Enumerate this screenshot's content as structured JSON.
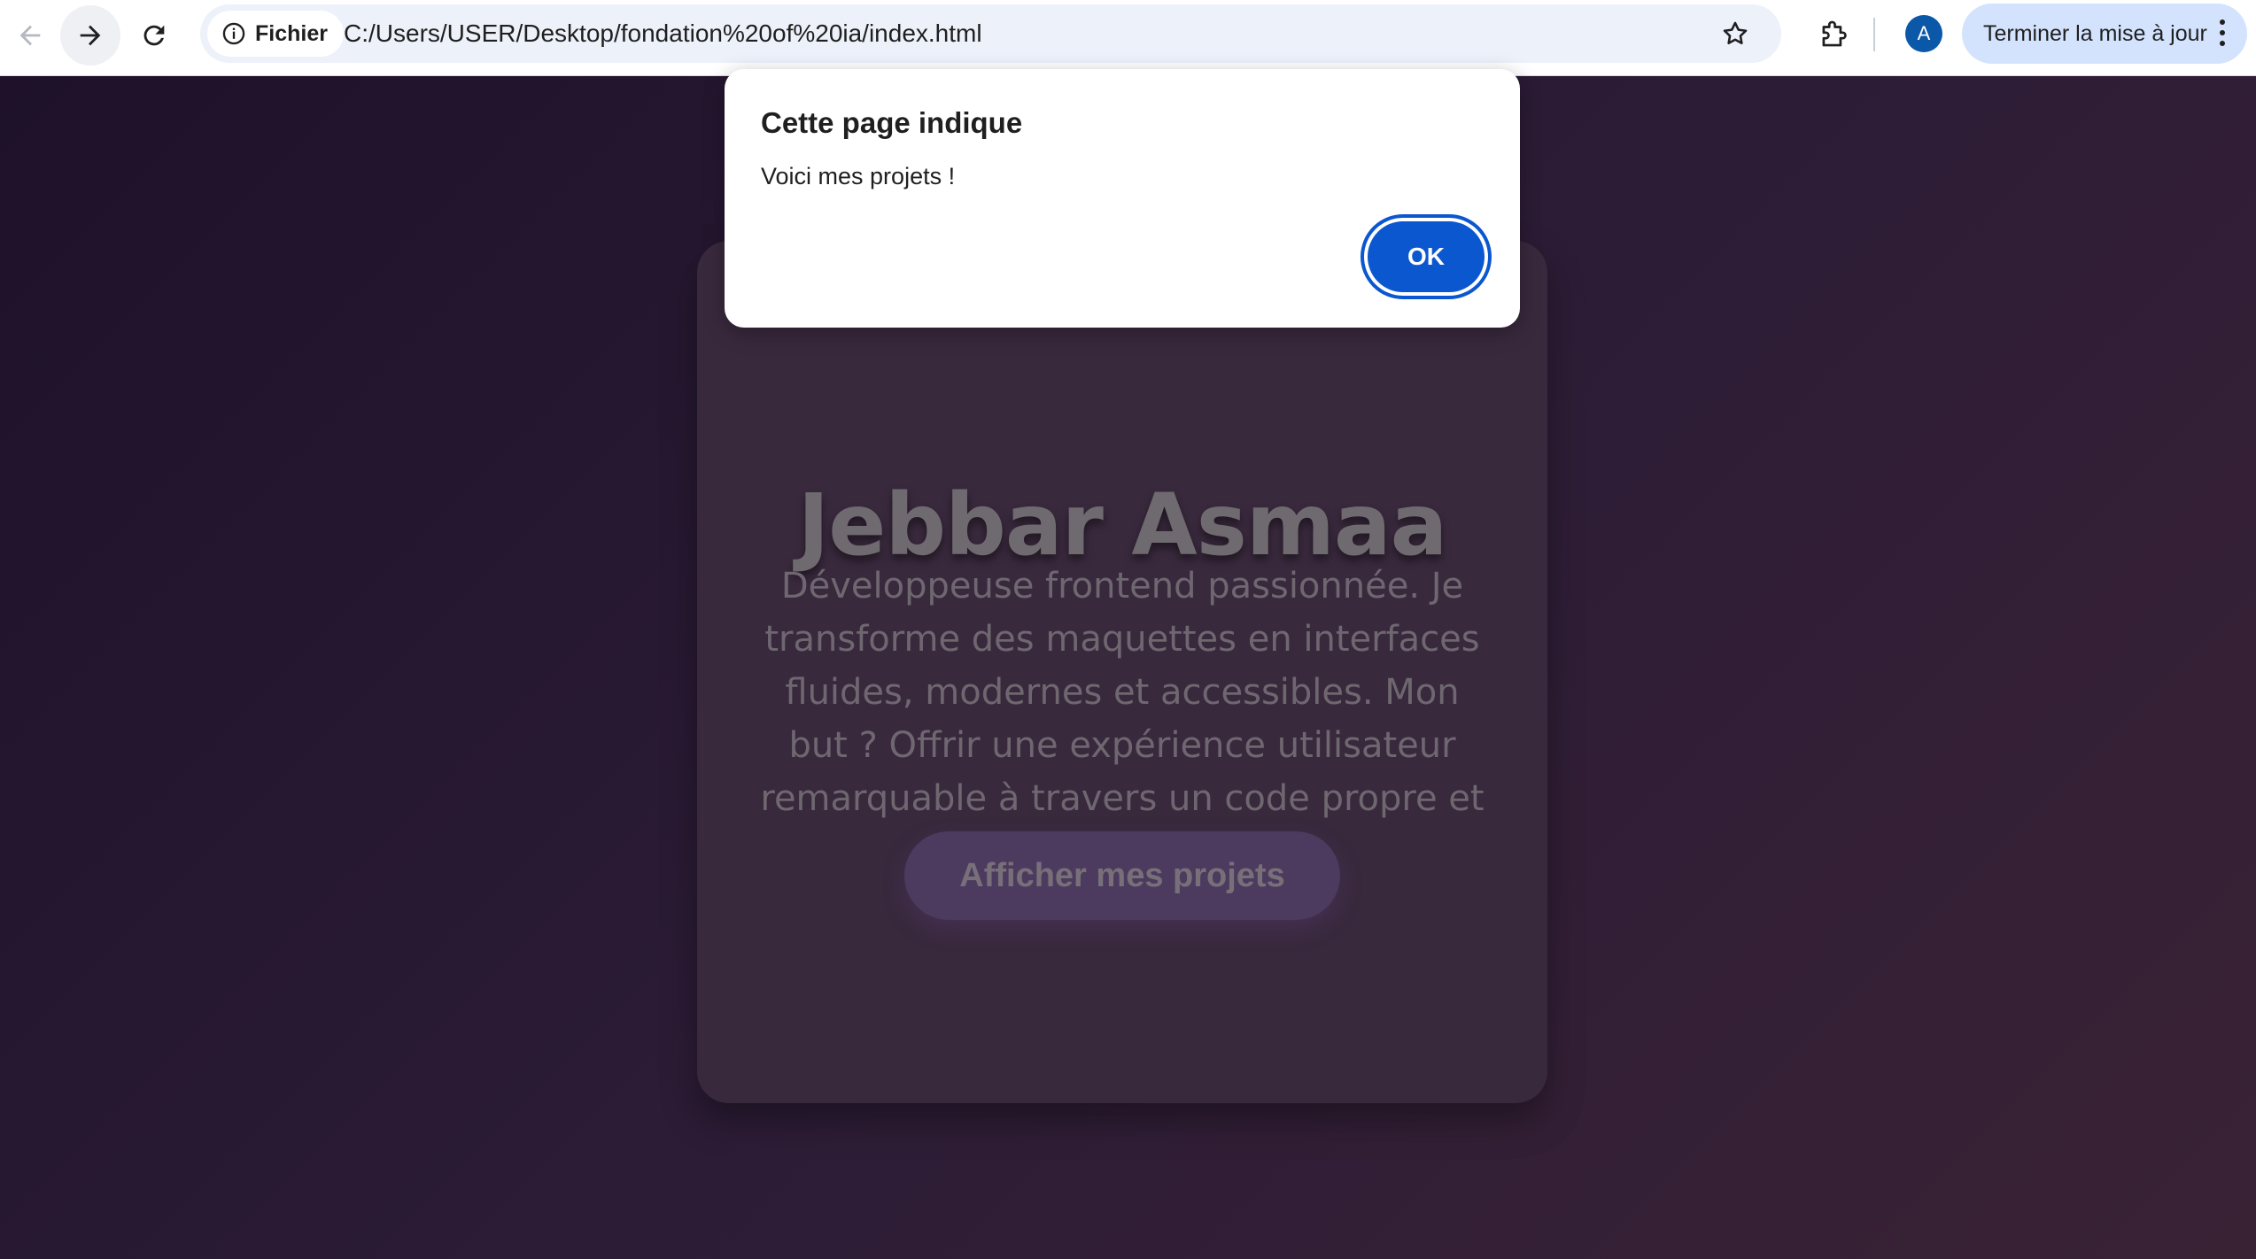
{
  "browser": {
    "site_chip_label": "Fichier",
    "url": "C:/Users/USER/Desktop/fondation%20of%20ia/index.html",
    "avatar_letter": "A",
    "update_label": "Terminer la mise à jour",
    "icons": {
      "back": "arrow-left-icon",
      "forward": "arrow-right-icon",
      "reload": "reload-icon",
      "site_info": "info-icon",
      "bookmark": "star-icon",
      "extensions": "puzzle-icon",
      "menu": "kebab-menu-icon"
    }
  },
  "page": {
    "name": "Jebbar Asmaa",
    "description": "Développeuse frontend passionnée. Je transforme des maquettes en interfaces fluides, modernes et accessibles. Mon but ? Offrir une expérience utilisateur remarquable à travers un code propre et créatif.",
    "cta_label": "Afficher mes projets"
  },
  "dialog": {
    "title": "Cette page indique",
    "message": "Voici mes projets !",
    "ok_label": "OK"
  },
  "colors": {
    "page_bg_start": "#1e1129",
    "page_bg_end": "#3a2235",
    "card_bg": "#3a2a3e",
    "cta_bg": "#4d3b5f",
    "dialog_ok": "#0b57d0",
    "update_button": "#d3e3fd",
    "avatar": "#0b57a8"
  }
}
